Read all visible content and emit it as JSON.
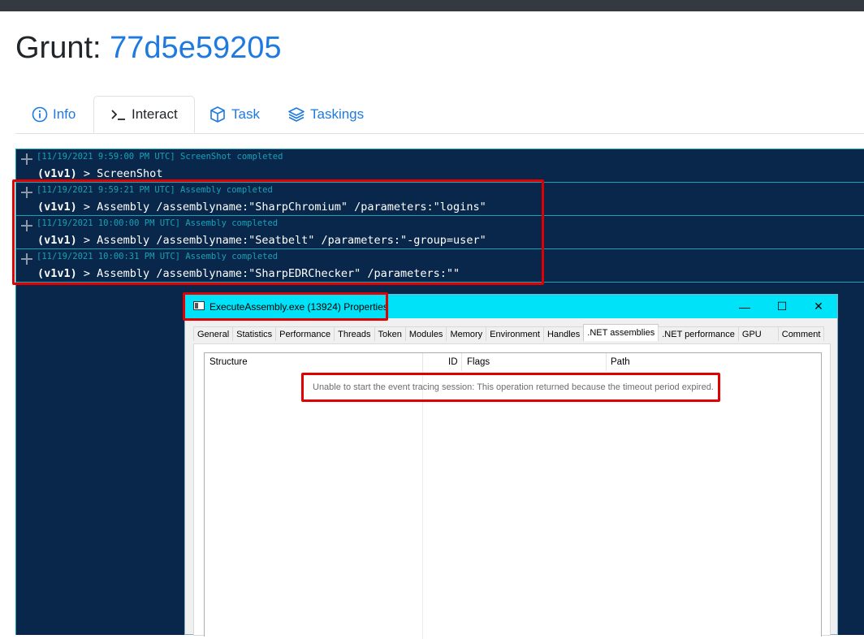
{
  "page": {
    "title_prefix": "Grunt: ",
    "grunt_id": "77d5e59205"
  },
  "tabs": [
    {
      "label": "Info",
      "icon": "info-circle-icon"
    },
    {
      "label": "Interact",
      "icon": "terminal-prompt-icon",
      "active": true
    },
    {
      "label": "Task",
      "icon": "cube-icon"
    },
    {
      "label": "Taskings",
      "icon": "layers-icon"
    }
  ],
  "console": {
    "entries": [
      {
        "header": "[11/19/2021 9:59:00 PM UTC] ScreenShot completed",
        "user": "(v1v1)",
        "command": " > ScreenShot"
      },
      {
        "header": "[11/19/2021 9:59:21 PM UTC] Assembly completed",
        "user": "(v1v1)",
        "command": " > Assembly /assemblyname:\"SharpChromium\" /parameters:\"logins\""
      },
      {
        "header": "[11/19/2021 10:00:00 PM UTC] Assembly completed",
        "user": "(v1v1)",
        "command": " > Assembly /assemblyname:\"Seatbelt\" /parameters:\"-group=user\""
      },
      {
        "header": "[11/19/2021 10:00:31 PM UTC] Assembly completed",
        "user": "(v1v1)",
        "command": " > Assembly /assemblyname:\"SharpEDRChecker\" /parameters:\"\""
      }
    ]
  },
  "window": {
    "title": "ExecuteAssembly.exe (13924) Properties",
    "controls": {
      "minimize": "—",
      "maximize": "☐",
      "close": "✕"
    },
    "tabs": [
      "General",
      "Statistics",
      "Performance",
      "Threads",
      "Token",
      "Modules",
      "Memory",
      "Environment",
      "Handles",
      ".NET assemblies",
      ".NET performance",
      "GPU",
      "Comment"
    ],
    "active_tab": ".NET assemblies",
    "columns": [
      "Structure",
      "ID",
      "Flags",
      "Path"
    ],
    "message": "Unable to start the event tracing session: This operation returned because the timeout period expired."
  },
  "colors": {
    "accent": "#1f7ae0",
    "console_bg": "#09274a",
    "console_border": "#17a2b8",
    "titlebar": "#00e2f7",
    "highlight": "#e00000"
  }
}
